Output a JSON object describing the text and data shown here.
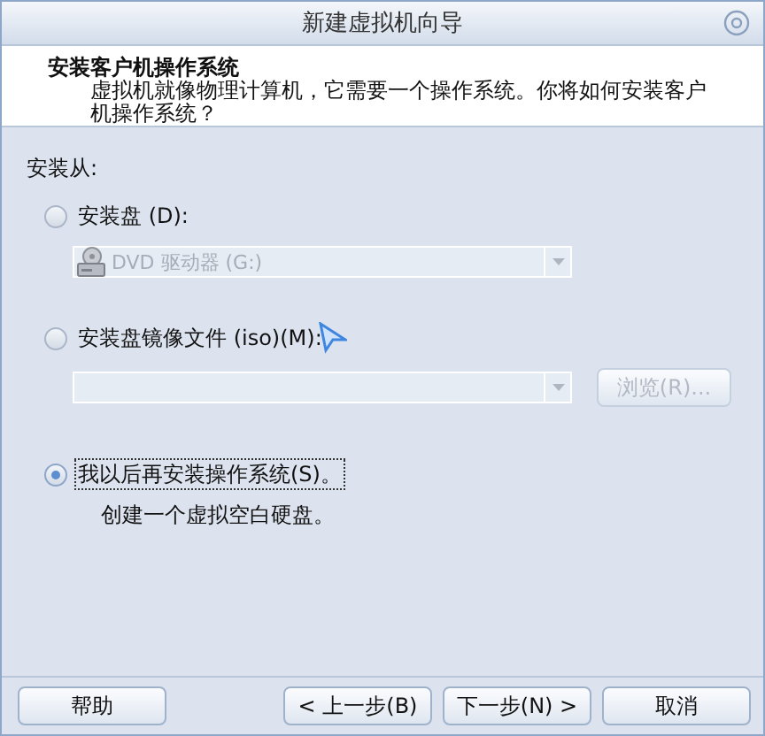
{
  "window": {
    "title": "新建虚拟机向导"
  },
  "header": {
    "title": "安装客户机操作系统",
    "description": "虚拟机就像物理计算机，它需要一个操作系统。你将如何安装客户机操作系统？"
  },
  "install_from_label": "安装从:",
  "options": [
    {
      "kind": "dropdown",
      "label": "安装盘 (D):",
      "selected": false,
      "dropdown": {
        "value": "DVD 驱动器 (G:)",
        "disabled": true
      }
    },
    {
      "kind": "file",
      "label": "安装盘镜像文件 (iso)(M):",
      "selected": false,
      "dropdown": {
        "disabled": true
      },
      "browse": {
        "label": "浏览(R)...",
        "disabled": true
      }
    },
    {
      "kind": "later",
      "label": "我以后再安装操作系统(S)。",
      "selected": true,
      "focused": true,
      "note": "创建一个虚拟空白硬盘。"
    }
  ],
  "buttons": {
    "help": "帮助",
    "back": "< 上一步(B)",
    "next": "下一步(N) >",
    "cancel": "取消"
  }
}
